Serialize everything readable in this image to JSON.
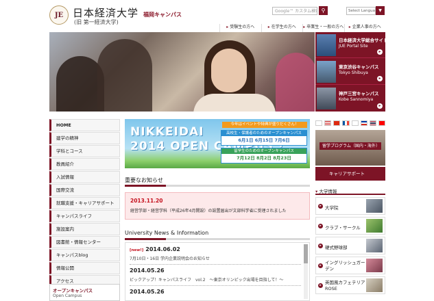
{
  "header": {
    "logo_mark": "JE",
    "logo_jp": "日本経済大学",
    "logo_sub": "(旧 第一経済大学)",
    "campus": "福岡キャンパス",
    "search_placeholder": "Google™ カスタム検索",
    "search_icon": "search-icon",
    "language_select": "Select Language"
  },
  "top_nav": [
    {
      "label": "受験生の方へ"
    },
    {
      "label": "在学生の方へ"
    },
    {
      "label": "卒業生・一般の方へ"
    },
    {
      "label": "企業人事の方へ"
    }
  ],
  "side_links": [
    {
      "title": "日本経済大学総合サイト",
      "sub": "JUE Portal Site"
    },
    {
      "title": "東京渋谷キャンパス",
      "sub": "Tokyo Shibuya"
    },
    {
      "title": "神戸三宮キャンパス",
      "sub": "Kobe Sannomiya"
    }
  ],
  "left_menu": [
    {
      "label": "HOME"
    },
    {
      "label": "建学の精神"
    },
    {
      "label": "学科とコース"
    },
    {
      "label": "教員紹介"
    },
    {
      "label": "入試情報"
    },
    {
      "label": "国際交流"
    },
    {
      "label": "就職支援・キャリアサポート"
    },
    {
      "label": "キャンパスライフ"
    },
    {
      "label": "施設案内"
    },
    {
      "label": "図書館・情報センター"
    },
    {
      "label": "キャンパスblog"
    },
    {
      "label": "情報公開"
    },
    {
      "label": "アクセス"
    }
  ],
  "open_campus_box": {
    "title": "オープンキャンパス",
    "sub": "Open Campus"
  },
  "banner": {
    "line1": "NIKKEIDAI",
    "line2": "2014 OPEN CAMPUS !",
    "tag": "今年はイベントや特典が盛りだくさん！",
    "box1_head": "高校生・保護者のためのオープンキャンパス",
    "box1_dates": "6月1日 6月15日 7月6日",
    "box2_head": "留学生のためのオープンキャンパス",
    "box2_dates": "7月12日 8月2日 8月23日"
  },
  "notice": {
    "title": "重要なお知らせ",
    "date": "2013.11.20",
    "text": "経営学部・経営学科（平成26年4月開設）の設置届出が文部科学省に受理されました"
  },
  "news": {
    "title": "University News & Information",
    "items": [
      {
        "badge": "[new!]",
        "date": "2014.06.02",
        "text": "7月10日・16日 学内企業説明会のお知らせ"
      },
      {
        "badge": "",
        "date": "2014.05.26",
        "text": "ピックアップ！キャンパスライフ　vol.2　～東京オリンピック出場を目指して！～"
      },
      {
        "badge": "",
        "date": "2014.05.26",
        "text": ""
      }
    ]
  },
  "right": {
    "program_label": "留学プログラム（国内・海外）",
    "career_label": "キャリアサポート",
    "info_head": "大学情報",
    "info_items": [
      {
        "label": "大学院"
      },
      {
        "label": "クラブ・サークル"
      },
      {
        "label": "硬式野球部"
      },
      {
        "label": "イングリッシュガーデン"
      },
      {
        "label": "英国風カフェテリアROSE"
      }
    ]
  },
  "colors": {
    "brand": "#7d1426",
    "notice_bg": "#fde9ea",
    "accent_red": "#c4101d"
  }
}
